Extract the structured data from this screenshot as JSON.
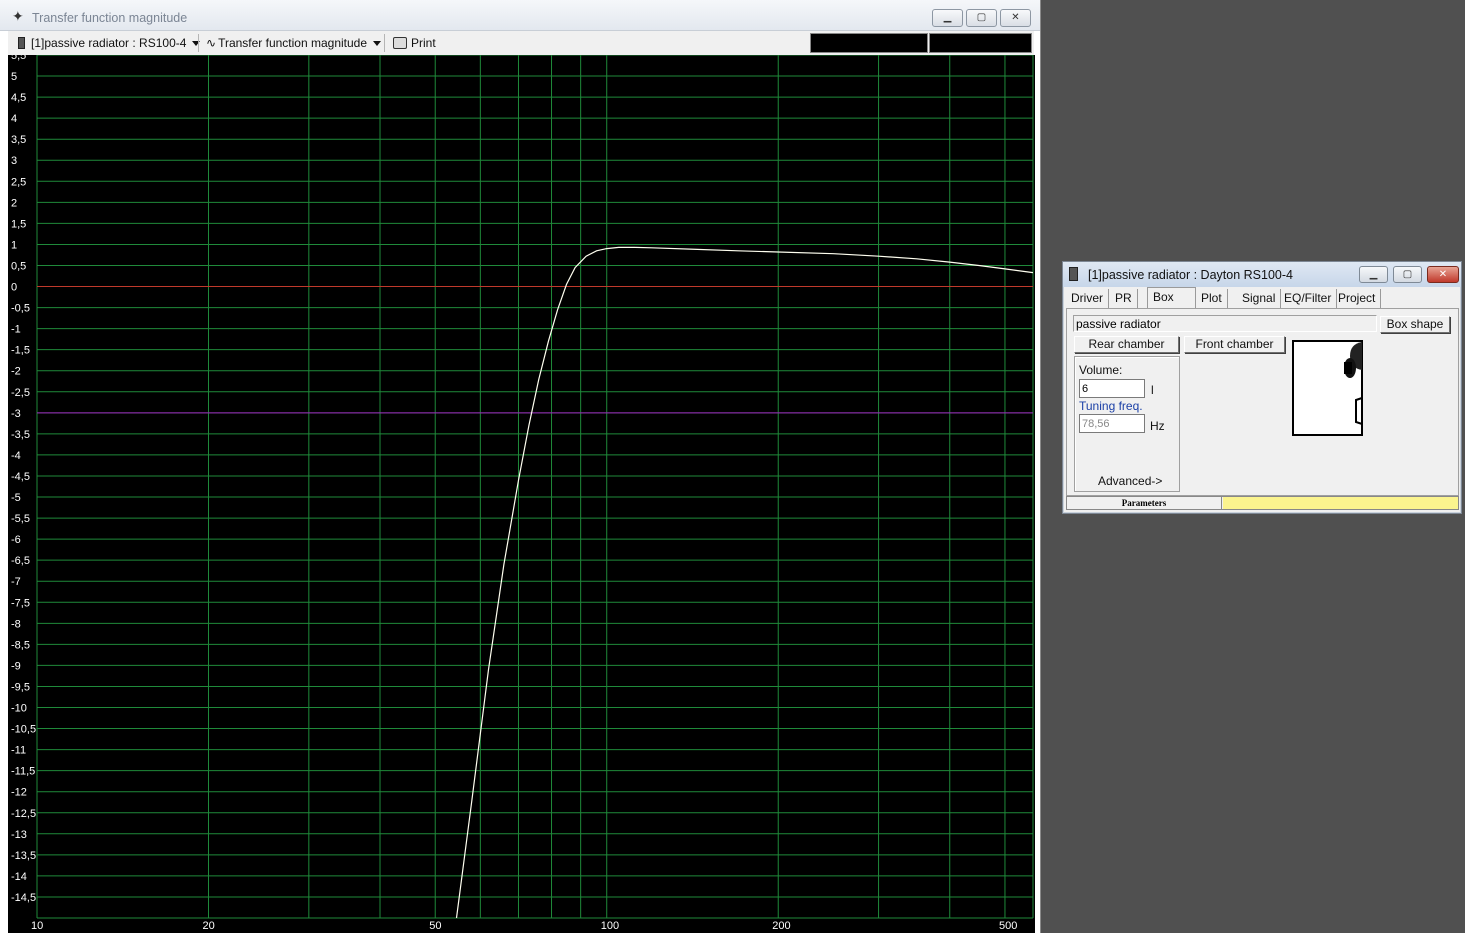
{
  "main_window": {
    "title": "Transfer function magnitude",
    "caption_buttons": {
      "minimize": "▁",
      "maximize": "▢",
      "close": "✕"
    },
    "toolbar": {
      "project_selector": "[1]passive radiator : RS100-4",
      "graph_selector": "Transfer function magnitude",
      "print_label": "Print"
    }
  },
  "chart_data": {
    "type": "line",
    "xscale": "log",
    "xlim": [
      10,
      560
    ],
    "ylim": [
      -15,
      5.5
    ],
    "x_ticks": [
      10,
      20,
      50,
      100,
      200,
      500
    ],
    "x_tick_labels": [
      "10",
      "20",
      "50",
      "100",
      "200",
      "500"
    ],
    "x_gridlines": [
      20,
      30,
      40,
      50,
      60,
      70,
      80,
      90,
      100,
      200,
      300,
      400,
      500
    ],
    "y_ticks": [
      5.5,
      5,
      4.5,
      4,
      3.5,
      3,
      2.5,
      2,
      1.5,
      1,
      0.5,
      0,
      -0.5,
      -1,
      -1.5,
      -2,
      -2.5,
      -3,
      -3.5,
      -4,
      -4.5,
      -5,
      -5.5,
      -6,
      -6.5,
      -7,
      -7.5,
      -8,
      -8.5,
      -9,
      -9.5,
      -10,
      -10.5,
      -11,
      -11.5,
      -12,
      -12.5,
      -13,
      -13.5,
      -14,
      -14.5
    ],
    "y_tick_labels": [
      "5,5",
      "5",
      "4,5",
      "4",
      "3,5",
      "3",
      "2,5",
      "2",
      "1,5",
      "1",
      "0,5",
      "0",
      "-0,5",
      "-1",
      "-1,5",
      "-2",
      "-2,5",
      "-3",
      "-3,5",
      "-4",
      "-4,5",
      "-5",
      "-5,5",
      "-6",
      "-6,5",
      "-7",
      "-7,5",
      "-8",
      "-8,5",
      "-9",
      "-9,5",
      "-10",
      "-10,5",
      "-11",
      "-11,5",
      "-12",
      "-12,5",
      "-13",
      "-13,5",
      "-14",
      "-14,5"
    ],
    "reference_lines": [
      {
        "y": 0,
        "color": "#c0392b"
      },
      {
        "y": -3,
        "color": "#a020c0"
      }
    ],
    "series": [
      {
        "color": "#fffff0",
        "x": [
          54.5,
          58,
          62,
          66,
          70,
          73,
          76,
          79,
          82,
          85,
          88,
          92,
          96,
          100,
          105,
          112,
          120,
          140,
          170,
          200,
          250,
          300,
          350,
          400,
          450,
          500,
          560
        ],
        "y": [
          -15,
          -12.2,
          -9.1,
          -6.6,
          -4.6,
          -3.3,
          -2.2,
          -1.3,
          -0.55,
          0.05,
          0.45,
          0.72,
          0.85,
          0.9,
          0.93,
          0.93,
          0.92,
          0.89,
          0.85,
          0.82,
          0.78,
          0.72,
          0.66,
          0.58,
          0.5,
          0.42,
          0.33
        ]
      }
    ],
    "grid": true,
    "grid_color": "#1f8a3a",
    "background": "#000000"
  },
  "param_window": {
    "title": "[1]passive radiator : Dayton RS100-4",
    "caption_buttons": {
      "minimize": "▁",
      "maximize": "▢",
      "close": "✕"
    },
    "tabs": [
      "Driver",
      "PR",
      "Box",
      "Plot",
      "Signal",
      "EQ/Filter",
      "Project"
    ],
    "active_tab": "Box",
    "box_name": "passive radiator",
    "box_shape_button": "Box shape",
    "rear_chamber_button": "Rear chamber",
    "front_chamber_button": "Front chamber",
    "volume_label": "Volume:",
    "volume_value": "6",
    "volume_unit": "l",
    "tuning_label": "Tuning freq.",
    "tuning_value": "78,56",
    "tuning_unit": "Hz",
    "advanced_button": "Advanced->",
    "status_left": "Parameters"
  }
}
